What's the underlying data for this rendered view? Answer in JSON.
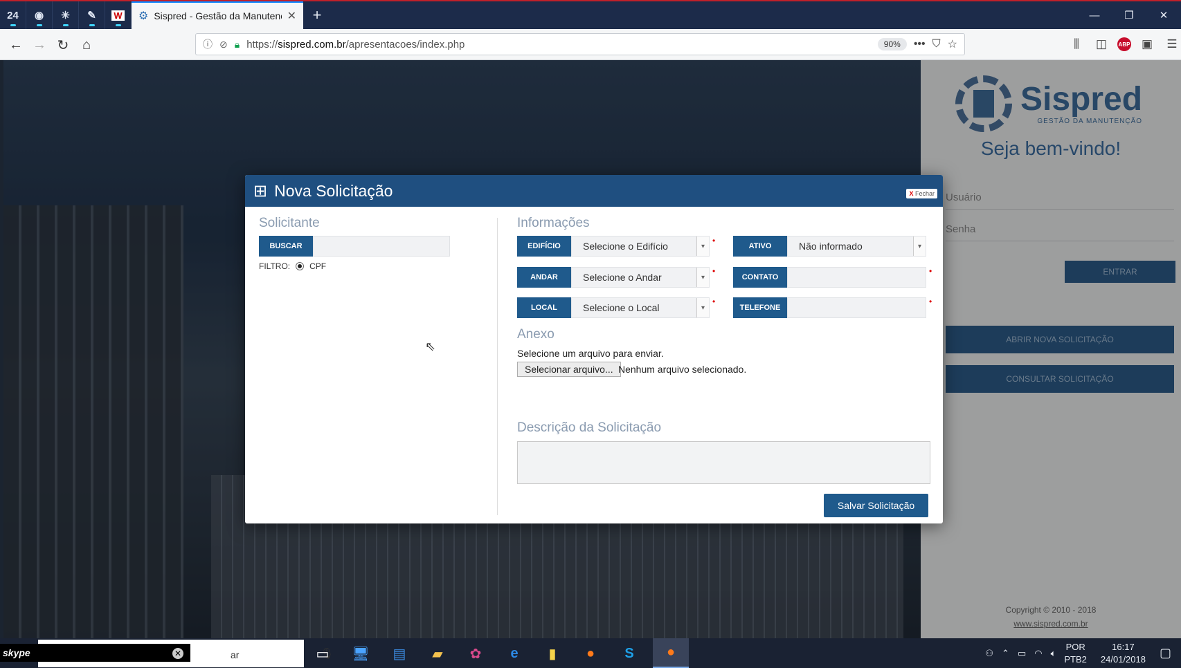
{
  "browser": {
    "pinned_tabs": [
      "24",
      "◉",
      "✳",
      "✎",
      "W"
    ],
    "active_tab_title": "Sispred - Gestão da Manutençã",
    "new_tab": "+",
    "url_prefix": "https://",
    "url_domain": "sispred.com.br",
    "url_path": "/apresentacoes/index.php",
    "zoom": "90%"
  },
  "login": {
    "brand": "Sispred",
    "brand_sub": "GESTÃO DA MANUTENÇÃO",
    "welcome": "Seja bem-vindo!",
    "user_placeholder": "Usuário",
    "pass_placeholder": "Senha",
    "enter": "ENTRAR",
    "open_request": "ABRIR NOVA SOLICITAÇÃO",
    "check_request": "CONSULTAR SOLICITAÇÃO",
    "copyright": "Copyright © 2010 - 2018",
    "site": "www.sispred.com.br"
  },
  "modal": {
    "title": "Nova Solicitação",
    "close": "Fechar",
    "close_x": "X",
    "solicitante_title": "Solicitante",
    "buscar": "BUSCAR",
    "buscar_value": "",
    "filtro_label": "FILTRO:",
    "filtro_option": "CPF",
    "info_title": "Informações",
    "edificio_label": "EDIFÍCIO",
    "edificio_value": "Selecione o Edifício",
    "andar_label": "ANDAR",
    "andar_value": "Selecione o Andar",
    "local_label": "LOCAL",
    "local_value": "Selecione o Local",
    "ativo_label": "ATIVO",
    "ativo_value": "Não informado",
    "contato_label": "CONTATO",
    "contato_value": "",
    "telefone_label": "TELEFONE",
    "telefone_value": "",
    "anexo_title": "Anexo",
    "anexo_text": "Selecione um arquivo para enviar.",
    "file_button": "Selecionar arquivo...",
    "file_status": "Nenhum arquivo selecionado.",
    "descricao_title": "Descrição da Solicitação",
    "descricao_value": "",
    "save": "Salvar Solicitação"
  },
  "taskbar": {
    "skype_label": "skype",
    "search_tail": "ar",
    "lang_top": "POR",
    "lang_bottom": "PTB2",
    "time": "16:17",
    "date": "24/01/2018"
  },
  "colors": {
    "primary": "#1f5a8c",
    "header": "#1f4f80",
    "tabbar": "#1c2b4a"
  }
}
